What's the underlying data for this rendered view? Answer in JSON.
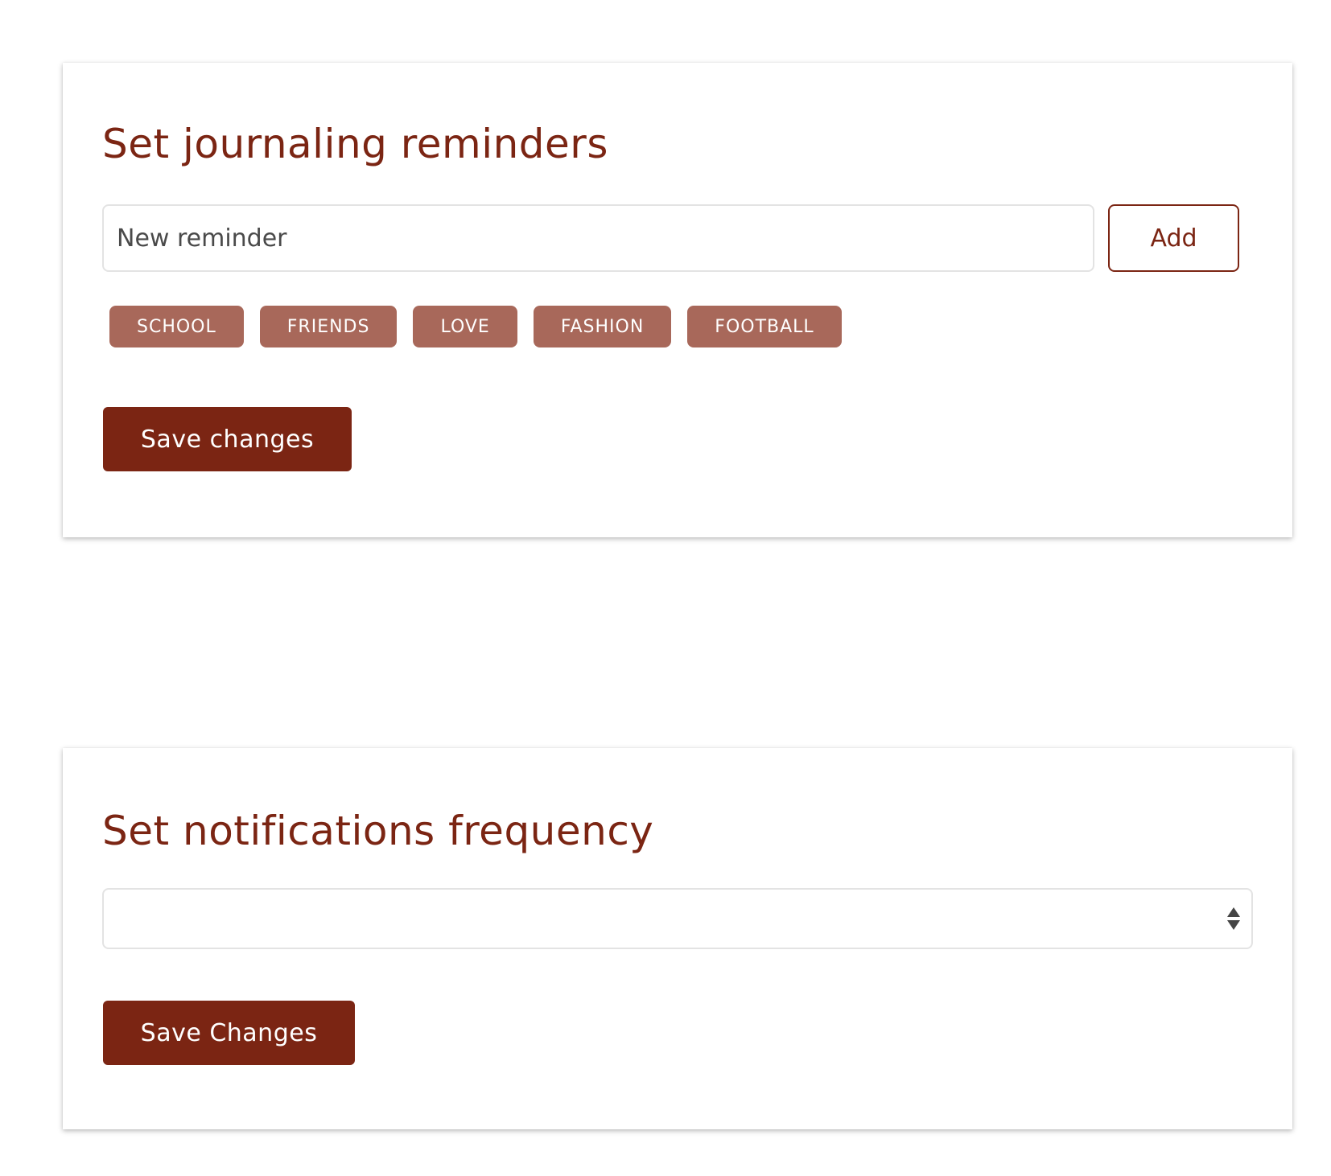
{
  "reminders": {
    "title": "Set journaling reminders",
    "input": {
      "placeholder": "New reminder",
      "value": ""
    },
    "add_label": "Add",
    "tags": [
      "SCHOOL",
      "FRIENDS",
      "LOVE",
      "FASHION",
      "FOOTBALL"
    ],
    "save_label": "Save changes"
  },
  "frequency": {
    "title": "Set notifications frequency",
    "select": {
      "value": ""
    },
    "save_label": "Save Changes"
  },
  "colors": {
    "primary": "#7b2513",
    "tag_background": "#a8685a",
    "input_border": "#e3e3e3"
  },
  "icons": {
    "select_arrows": "select-arrows-icon"
  }
}
